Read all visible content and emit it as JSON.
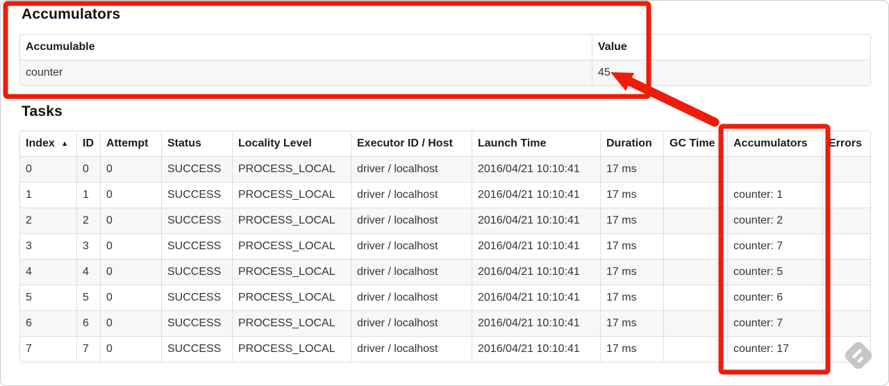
{
  "accumulators": {
    "heading": "Accumulators",
    "columns": [
      "Accumulable",
      "Value"
    ],
    "rows": [
      [
        "counter",
        "45"
      ]
    ]
  },
  "tasks": {
    "heading": "Tasks",
    "columns": [
      "Index",
      "ID",
      "Attempt",
      "Status",
      "Locality Level",
      "Executor ID / Host",
      "Launch Time",
      "Duration",
      "GC Time",
      "Accumulators",
      "Errors"
    ],
    "sort": {
      "column": "Index",
      "glyph": "▲",
      "direction": "ascending"
    },
    "rows": [
      [
        "0",
        "0",
        "0",
        "SUCCESS",
        "PROCESS_LOCAL",
        "driver / localhost",
        "2016/04/21 10:10:41",
        "17 ms",
        "",
        "",
        ""
      ],
      [
        "1",
        "1",
        "0",
        "SUCCESS",
        "PROCESS_LOCAL",
        "driver / localhost",
        "2016/04/21 10:10:41",
        "17 ms",
        "",
        "counter: 1",
        ""
      ],
      [
        "2",
        "2",
        "0",
        "SUCCESS",
        "PROCESS_LOCAL",
        "driver / localhost",
        "2016/04/21 10:10:41",
        "17 ms",
        "",
        "counter: 2",
        ""
      ],
      [
        "3",
        "3",
        "0",
        "SUCCESS",
        "PROCESS_LOCAL",
        "driver / localhost",
        "2016/04/21 10:10:41",
        "17 ms",
        "",
        "counter: 7",
        ""
      ],
      [
        "4",
        "4",
        "0",
        "SUCCESS",
        "PROCESS_LOCAL",
        "driver / localhost",
        "2016/04/21 10:10:41",
        "17 ms",
        "",
        "counter: 5",
        ""
      ],
      [
        "5",
        "5",
        "0",
        "SUCCESS",
        "PROCESS_LOCAL",
        "driver / localhost",
        "2016/04/21 10:10:41",
        "17 ms",
        "",
        "counter: 6",
        ""
      ],
      [
        "6",
        "6",
        "0",
        "SUCCESS",
        "PROCESS_LOCAL",
        "driver / localhost",
        "2016/04/21 10:10:41",
        "17 ms",
        "",
        "counter: 7",
        ""
      ],
      [
        "7",
        "7",
        "0",
        "SUCCESS",
        "PROCESS_LOCAL",
        "driver / localhost",
        "2016/04/21 10:10:41",
        "17 ms",
        "",
        "counter: 17",
        ""
      ]
    ]
  },
  "annotations": {
    "color": "#ee1d0b",
    "highlighted_value": "45",
    "highlighted_column": "Accumulators"
  },
  "watermark": {
    "icon": "skitch-watermark"
  }
}
